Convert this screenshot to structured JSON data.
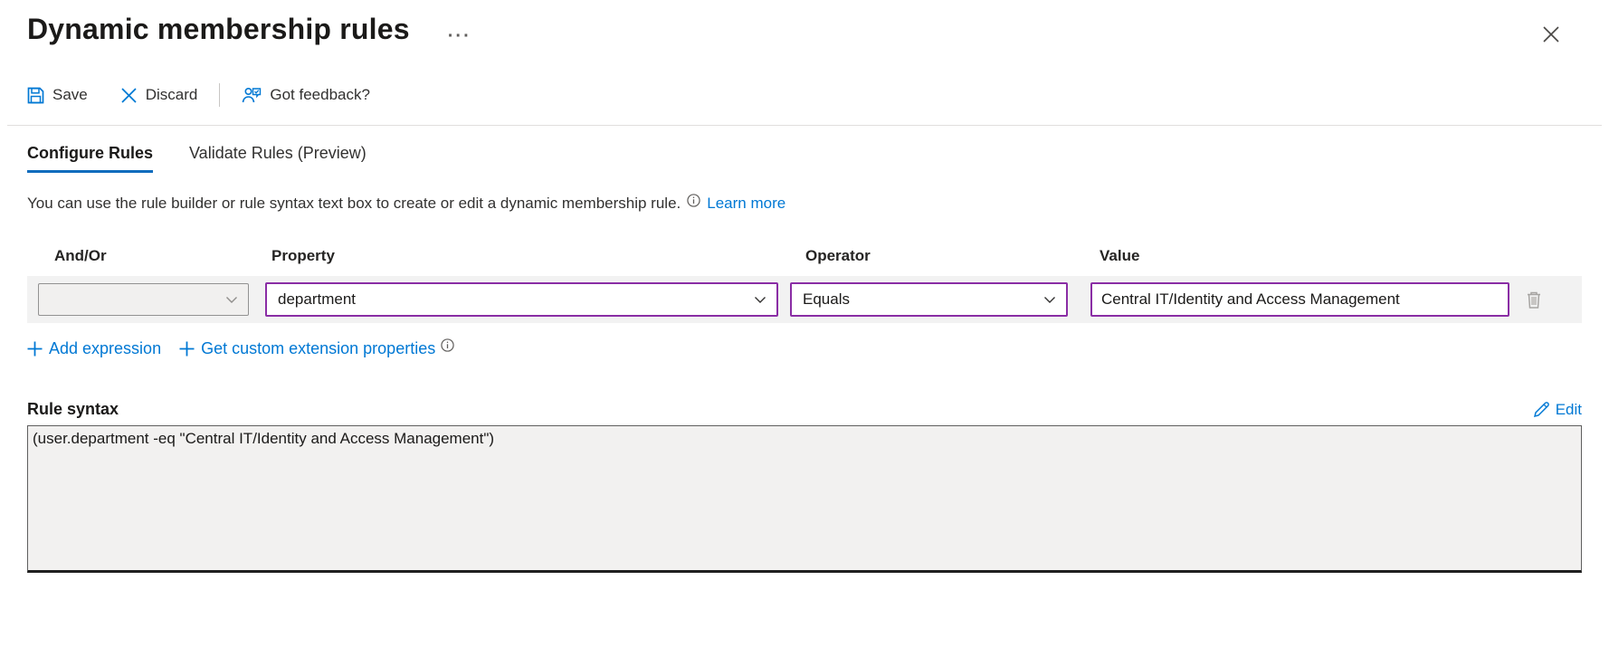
{
  "header": {
    "title": "Dynamic membership rules",
    "more_options_glyph": "···"
  },
  "toolbar": {
    "save_label": "Save",
    "discard_label": "Discard",
    "feedback_label": "Got feedback?"
  },
  "tabs": [
    {
      "label": "Configure Rules",
      "active": true
    },
    {
      "label": "Validate Rules (Preview)",
      "active": false
    }
  ],
  "description": {
    "text": "You can use the rule builder or rule syntax text box to create or edit a dynamic membership rule.",
    "learn_more_label": "Learn more"
  },
  "rule_builder": {
    "columns": {
      "and_or": "And/Or",
      "property": "Property",
      "operator": "Operator",
      "value": "Value"
    },
    "rows": [
      {
        "and_or": "",
        "property": "department",
        "operator": "Equals",
        "value": "Central IT/Identity and Access Management"
      }
    ],
    "add_expression_label": "Add expression",
    "get_custom_label": "Get custom extension properties"
  },
  "rule_syntax": {
    "label": "Rule syntax",
    "edit_label": "Edit",
    "content": "(user.department -eq \"Central IT/Identity and Access Management\")"
  },
  "icons": {
    "save": "floppy-disk-icon",
    "discard": "x-icon",
    "feedback": "person-chat-icon",
    "info": "info-circle-icon",
    "chevron": "chevron-down-icon",
    "delete": "trash-icon",
    "edit": "pencil-icon",
    "close": "close-icon",
    "add": "plus-icon",
    "more": "ellipsis-icon"
  },
  "colors": {
    "accent_blue": "#0078d4",
    "changed_purple": "#8a2da5",
    "row_band_gray": "#f2f2f2",
    "text_dark": "#323130"
  }
}
